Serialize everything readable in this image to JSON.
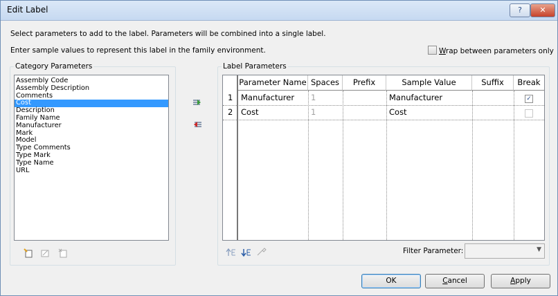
{
  "window": {
    "title": "Edit Label",
    "help_label": "?",
    "close_label": "✕"
  },
  "instructions": {
    "line1": "Select parameters to add to the label.  Parameters will be combined into a single label.",
    "line2": "Enter sample values to represent this label in the family environment."
  },
  "wrap_option": {
    "label_prefix": "W",
    "label_rest": "rap between parameters only",
    "checked": false
  },
  "category": {
    "label": "Category Parameters",
    "items": [
      "Assembly Code",
      "Assembly Description",
      "Comments",
      "Cost",
      "Description",
      "Family Name",
      "Manufacturer",
      "Mark",
      "Model",
      "Type Comments",
      "Type Mark",
      "Type Name",
      "URL"
    ],
    "selected": "Cost"
  },
  "label_params": {
    "label": "Label Parameters",
    "columns": [
      "Parameter Name",
      "Spaces",
      "Prefix",
      "Sample Value",
      "Suffix",
      "Break"
    ],
    "rows": [
      {
        "num": "1",
        "name": "Manufacturer",
        "spaces": "1",
        "prefix": "",
        "sample": "Manufacturer",
        "suffix": "",
        "break": true
      },
      {
        "num": "2",
        "name": "Cost",
        "spaces": "1",
        "prefix": "",
        "sample": "Cost",
        "suffix": "",
        "break": false
      }
    ]
  },
  "filter": {
    "label": "Filter Parameter:",
    "value": ""
  },
  "buttons": {
    "ok": "OK",
    "cancel_prefix": "C",
    "cancel_rest": "ancel",
    "apply_prefix": "A",
    "apply_rest": "pply"
  },
  "icons": {
    "add": "add-parameter-icon",
    "remove": "remove-parameter-icon",
    "new": "new-parameter-icon",
    "edit": "edit-parameter-icon",
    "delete": "delete-parameter-icon",
    "move_up": "move-up-icon",
    "move_down": "move-down-icon",
    "edit_label_params": "edit-label-params-icon"
  }
}
